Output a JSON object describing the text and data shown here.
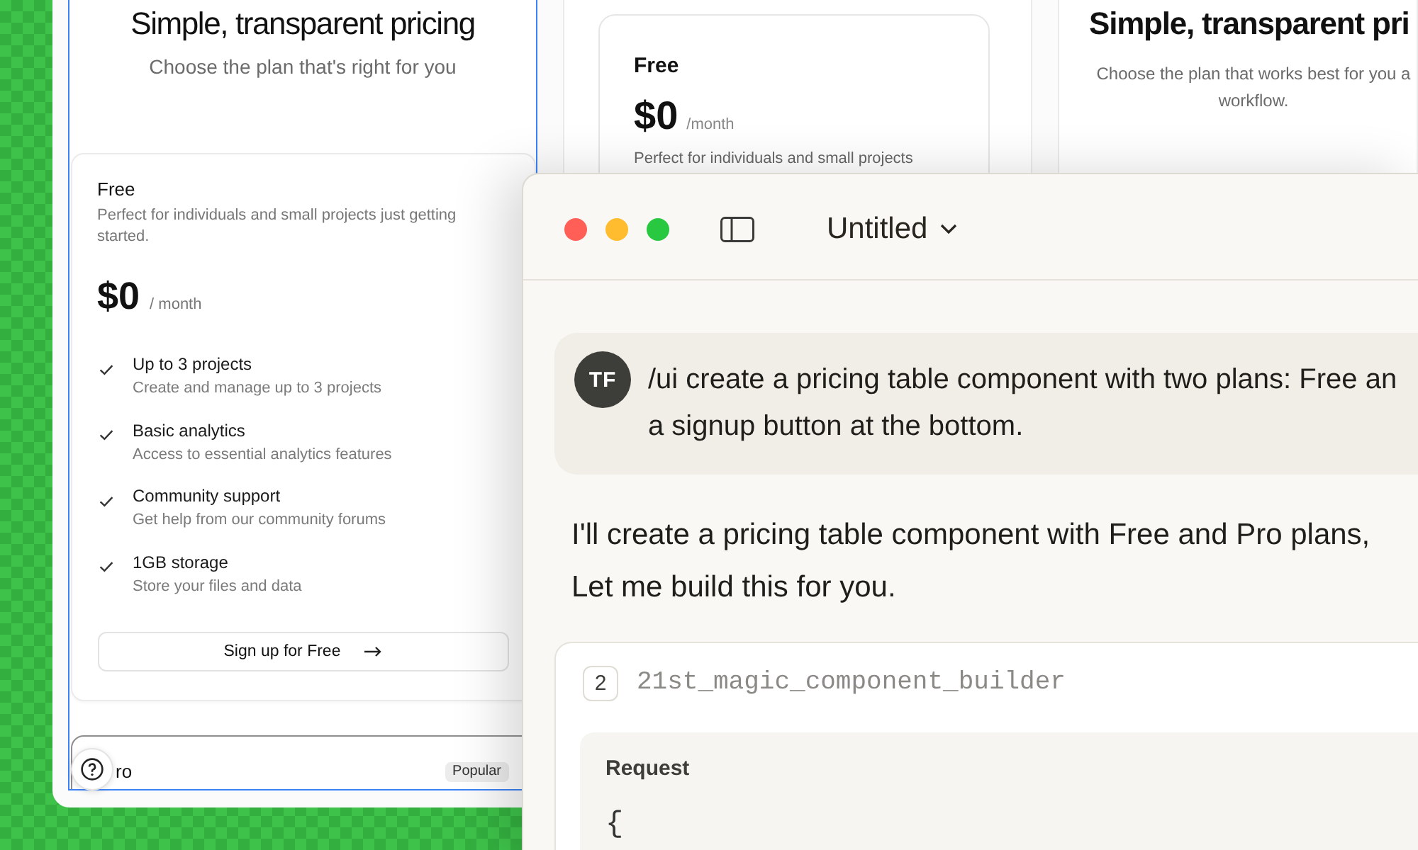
{
  "canvas": {
    "frames": [
      {
        "kind": "pricing_page",
        "selected": true,
        "heading": "Simple, transparent pricing",
        "subheading": [
          "Choose the plan that's right for you"
        ],
        "plans": [
          {
            "name": "Free",
            "featured": false,
            "description": "Perfect for individuals and small projects just getting started.",
            "price": "$0",
            "period": "/ month",
            "features": [
              {
                "title": "Up to 3 projects",
                "detail": "Create and manage up to 3 projects"
              },
              {
                "title": "Basic analytics",
                "detail": "Access to essential analytics features"
              },
              {
                "title": "Community support",
                "detail": "Get help from our community forums"
              },
              {
                "title": "1GB storage",
                "detail": "Store your files and data"
              }
            ],
            "button": "Sign up for Free"
          },
          {
            "name": "ro",
            "featured": true,
            "badge": "Popular"
          }
        ]
      },
      {
        "kind": "plan_card",
        "selected": false,
        "plan": {
          "name": "Free",
          "price": "$0",
          "period": "/month",
          "description": "Perfect for individuals and small projects"
        }
      },
      {
        "kind": "page_header",
        "selected": false,
        "heading": "Simple, transparent pri",
        "subheading": [
          "Choose the plan that works best for you a",
          "workflow."
        ]
      }
    ]
  },
  "chat_window": {
    "title": "Untitled",
    "messages": [
      {
        "kind": "user",
        "avatar": "TF",
        "lines": [
          "/ui create a pricing table component with two plans: Free an",
          "a signup button at the bottom."
        ]
      },
      {
        "kind": "assistant",
        "lines": [
          "I'll create a pricing table component with Free and Pro plans,",
          "Let me build this for you."
        ]
      }
    ],
    "tool_call": {
      "step": "2",
      "name": "21st_magic_component_builder",
      "section": "Request",
      "code": "{"
    }
  }
}
